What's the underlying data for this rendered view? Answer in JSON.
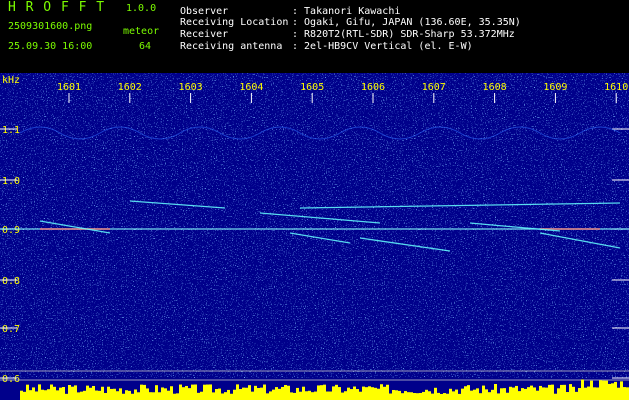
{
  "app": {
    "name": "H R O F F T",
    "version": "1.0.0",
    "filename": "2509301600.png",
    "datetime": "25.09.30 16:00",
    "meteor_label": "meteor",
    "meteor_count": "64"
  },
  "info": {
    "observer_label": "Observer",
    "observer_value": ": Takanori Kawachi",
    "location_label": "Receiving Location",
    "location_value": ": Ogaki, Gifu, JAPAN (136.60E, 35.35N)",
    "receiver_label": "Receiver",
    "receiver_value": ": R820T2(RTL-SDR) SDR-Sharp 53.372MHz",
    "antenna_label": "Receiving antenna",
    "antenna_value": ": 2el-HB9CV Vertical (el. E-W)"
  },
  "axes": {
    "y_unit": "kHz",
    "y_ticks": [
      "1.1",
      "1.0",
      "0.9",
      "0.8",
      "0.7",
      "0.6"
    ],
    "x_ticks": [
      "1601",
      "1602",
      "1603",
      "1604",
      "1605",
      "1606",
      "1607",
      "1608",
      "1609",
      "1610"
    ]
  },
  "colors": {
    "background": "#00008B",
    "tick_label": "#FFFF00",
    "header_green": "#7CFC00",
    "level_bar": "#FFFF00",
    "carrier_line": "#88FFFF"
  }
}
